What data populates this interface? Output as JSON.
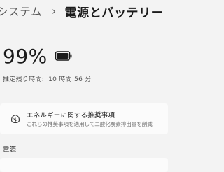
{
  "breadcrumb": {
    "parent": "システム",
    "separator": "›",
    "current": "電源とバッテリー"
  },
  "battery": {
    "percent_text": "99%",
    "level": 0.99,
    "icon": "battery-icon",
    "remaining_label": "推定残り時間:",
    "remaining_value": "10 時間 56 分"
  },
  "energy_card": {
    "icon": "leaf-icon",
    "title": "エネルギーに関する推奨事項",
    "description": "これらの推奨事項を適用して二酸化炭素排出量を削減"
  },
  "power_section": {
    "label": "電源"
  }
}
